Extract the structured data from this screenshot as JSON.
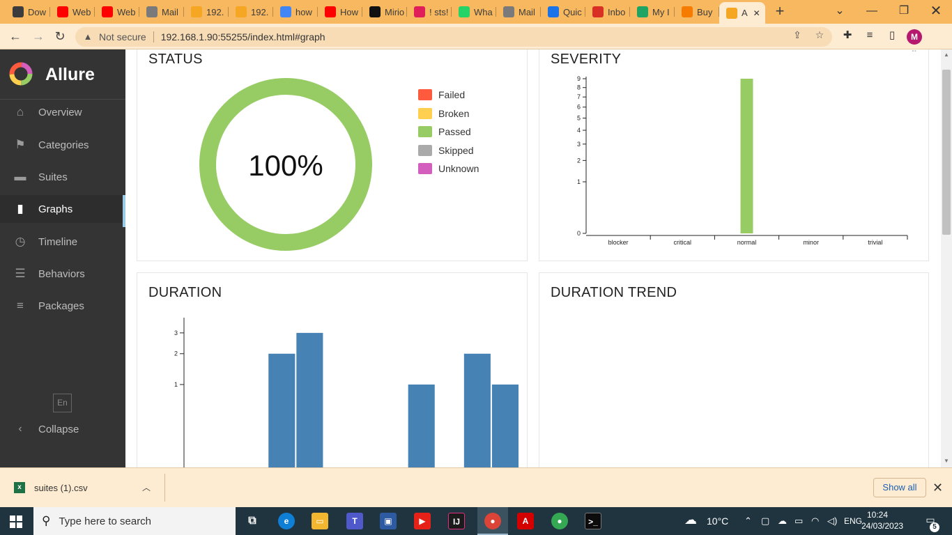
{
  "browser": {
    "tabs": [
      {
        "label": "Dow",
        "icon": "download-icon",
        "color": "#3c3c3c"
      },
      {
        "label": "Web",
        "icon": "youtube-icon",
        "color": "#ff0000"
      },
      {
        "label": "Web",
        "icon": "youtube-icon",
        "color": "#ff0000"
      },
      {
        "label": "Mail",
        "icon": "proxy-site-icon",
        "color": "#7a7a7a"
      },
      {
        "label": "192.",
        "icon": "allure-icon",
        "color": "#f5a623"
      },
      {
        "label": "192.",
        "icon": "allure-icon",
        "color": "#f5a623"
      },
      {
        "label": "how",
        "icon": "google-icon",
        "color": "#4285f4"
      },
      {
        "label": "How",
        "icon": "youtube-icon",
        "color": "#ff0000"
      },
      {
        "label": "Mirio",
        "icon": "github-icon",
        "color": "#111111"
      },
      {
        "label": "! sts!",
        "icon": "slack-icon",
        "color": "#e01e5a"
      },
      {
        "label": "Wha",
        "icon": "whatsapp-icon",
        "color": "#25d366"
      },
      {
        "label": "Mail",
        "icon": "proxy-site-icon",
        "color": "#7a7a7a"
      },
      {
        "label": "Quic",
        "icon": "quora-icon",
        "color": "#1a73e8"
      },
      {
        "label": "Inbo",
        "icon": "gmail-icon",
        "color": "#d93025"
      },
      {
        "label": "My I",
        "icon": "drive-icon",
        "color": "#1fa463"
      },
      {
        "label": "Buy",
        "icon": "orange-site-icon",
        "color": "#f57c00"
      },
      {
        "label": "A",
        "icon": "allure-icon",
        "color": "#f5a623",
        "active": true
      }
    ],
    "url": "192.168.1.90:55255/index.html#graph",
    "security_label": "Not secure",
    "profile_initial": "M"
  },
  "sidebar": {
    "brand": "Allure",
    "items": [
      {
        "label": "Overview",
        "icon": "home-icon"
      },
      {
        "label": "Categories",
        "icon": "flag-icon"
      },
      {
        "label": "Suites",
        "icon": "briefcase-icon"
      },
      {
        "label": "Graphs",
        "icon": "bar-chart-icon",
        "active": true
      },
      {
        "label": "Timeline",
        "icon": "clock-icon"
      },
      {
        "label": "Behaviors",
        "icon": "list-icon"
      },
      {
        "label": "Packages",
        "icon": "align-left-icon"
      }
    ],
    "language": "En",
    "collapse_label": "Collapse"
  },
  "widgets": {
    "status": {
      "title": "STATUS",
      "percent_label": "100%",
      "legend": [
        {
          "label": "Failed",
          "color": "#fd5a3e"
        },
        {
          "label": "Broken",
          "color": "#ffd050"
        },
        {
          "label": "Passed",
          "color": "#97cc64"
        },
        {
          "label": "Skipped",
          "color": "#aaaaaa"
        },
        {
          "label": "Unknown",
          "color": "#d35ebe"
        }
      ]
    },
    "severity": {
      "title": "SEVERITY"
    },
    "duration": {
      "title": "DURATION"
    },
    "duration_trend": {
      "title": "DURATION TREND"
    }
  },
  "chart_data": [
    {
      "type": "pie",
      "title": "STATUS",
      "categories": [
        "Failed",
        "Broken",
        "Passed",
        "Skipped",
        "Unknown"
      ],
      "values": [
        0,
        0,
        100,
        0,
        0
      ],
      "center_label": "100%",
      "colors": [
        "#fd5a3e",
        "#ffd050",
        "#97cc64",
        "#aaaaaa",
        "#d35ebe"
      ]
    },
    {
      "type": "bar",
      "title": "SEVERITY",
      "categories": [
        "blocker",
        "critical",
        "normal",
        "minor",
        "trivial"
      ],
      "values": [
        0,
        0,
        9,
        0,
        0
      ],
      "yticks": [
        0,
        1,
        2,
        3,
        4,
        5,
        6,
        7,
        8,
        9
      ],
      "ylim": [
        0,
        9
      ],
      "yscale": "sqrt",
      "color": "#97cc64"
    },
    {
      "type": "bar",
      "title": "DURATION",
      "values": [
        0,
        0,
        0,
        2,
        3,
        0,
        0,
        0,
        1,
        0,
        2,
        1
      ],
      "yticks": [
        1,
        2,
        3
      ],
      "ylim": [
        0,
        3
      ],
      "color": "#4682b4"
    }
  ],
  "downloads": {
    "file_name": "suites (1).csv",
    "show_all_label": "Show all"
  },
  "taskbar": {
    "search_placeholder": "Type here to search",
    "weather": "10°C",
    "language": "ENG",
    "time": "10:24",
    "date": "24/03/2023",
    "notification_count": "5"
  }
}
